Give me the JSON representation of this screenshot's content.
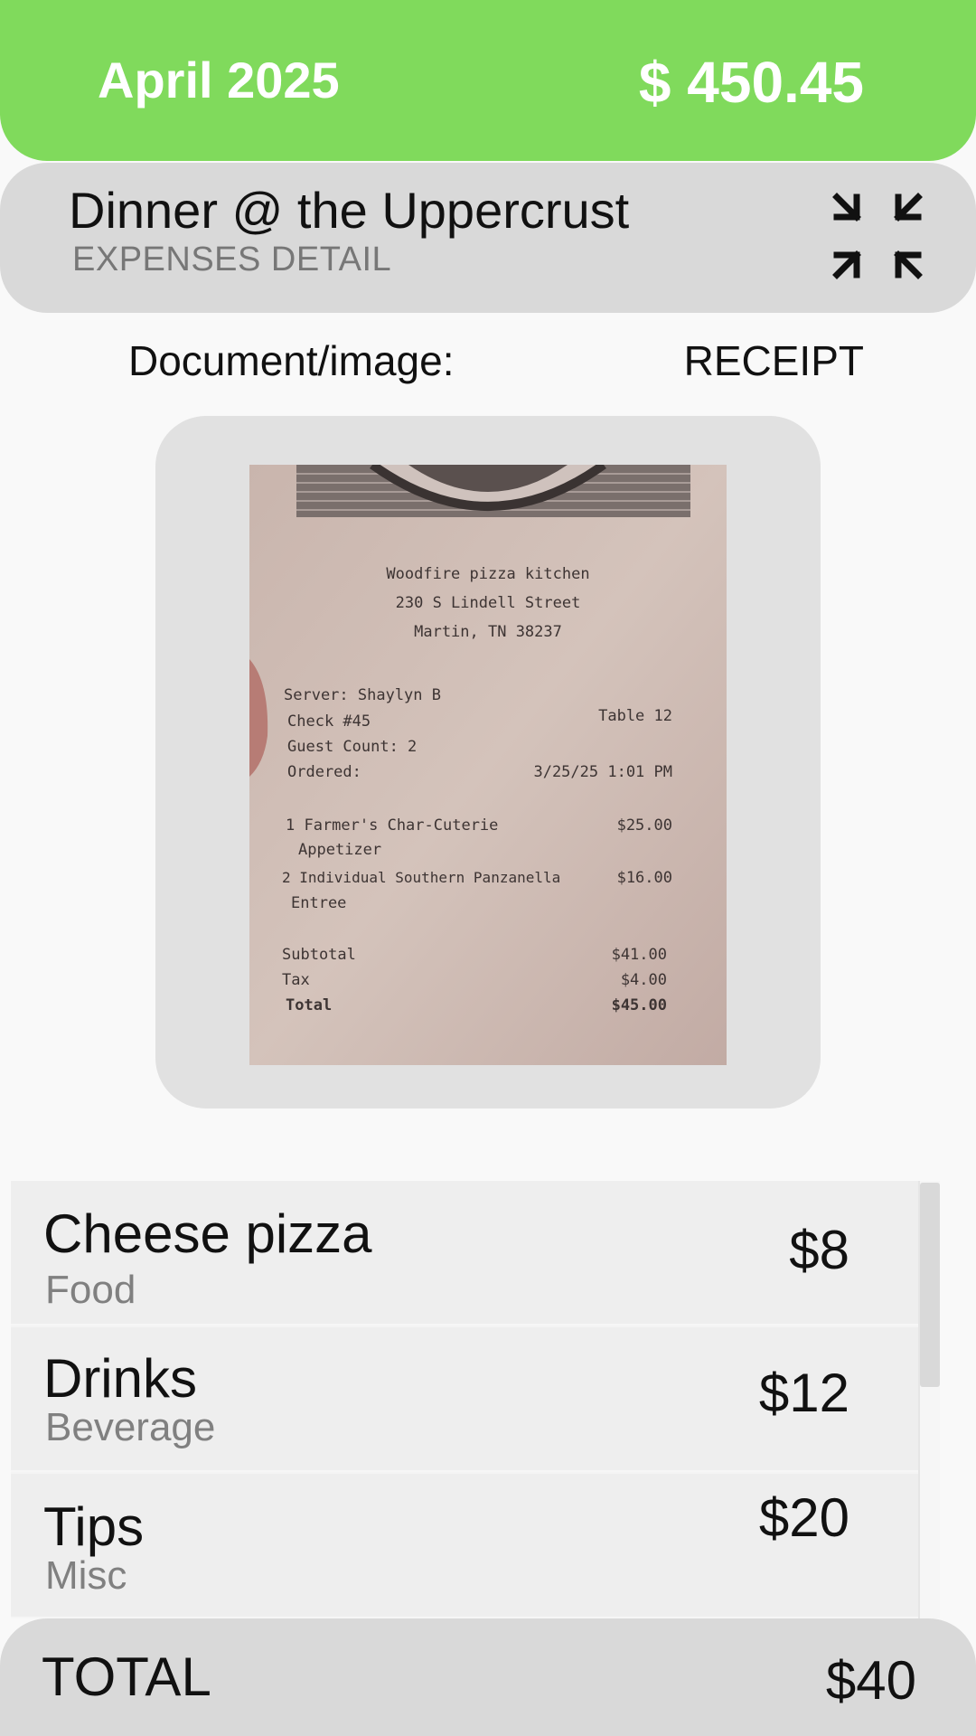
{
  "header": {
    "month": "April 2025",
    "total": "$ 450.45"
  },
  "expense": {
    "title": "Dinner @ the Uppercrust",
    "subtitle": "EXPENSES DETAIL",
    "collapse_icon": "collapse-arrows-icon"
  },
  "document": {
    "label": "Document/image:",
    "type": "RECEIPT"
  },
  "receipt": {
    "restaurant": "Woodfire pizza kitchen",
    "address1": "230 S Lindell Street",
    "address2": "Martin, TN 38237",
    "server": "Server: Shaylyn B",
    "check": "Check #45",
    "table": "Table 12",
    "guests": "Guest Count: 2",
    "ordered_label": "Ordered:",
    "ordered_time": "3/25/25 1:01 PM",
    "item1": "1 Farmer's Char-Cuterie",
    "item1_sub": "Appetizer",
    "item1_price": "$25.00",
    "item2": "2 Individual Southern Panzanella",
    "item2_sub": "Entree",
    "item2_price": "$16.00",
    "subtotal_label": "Subtotal",
    "subtotal": "$41.00",
    "tax_label": "Tax",
    "tax": "$4.00",
    "total_label": "Total",
    "total": "$45.00"
  },
  "items": [
    {
      "name": "Cheese pizza",
      "category": "Food",
      "amount": "$8"
    },
    {
      "name": "Drinks",
      "category": "Beverage",
      "amount": "$12"
    },
    {
      "name": "Tips",
      "category": "Misc",
      "amount": "$20"
    }
  ],
  "footer": {
    "label": "TOTAL",
    "value": "$40"
  },
  "colors": {
    "header_bg": "#80da5c",
    "panel_bg": "#d9d9d9",
    "row_bg": "#eeeeee"
  }
}
